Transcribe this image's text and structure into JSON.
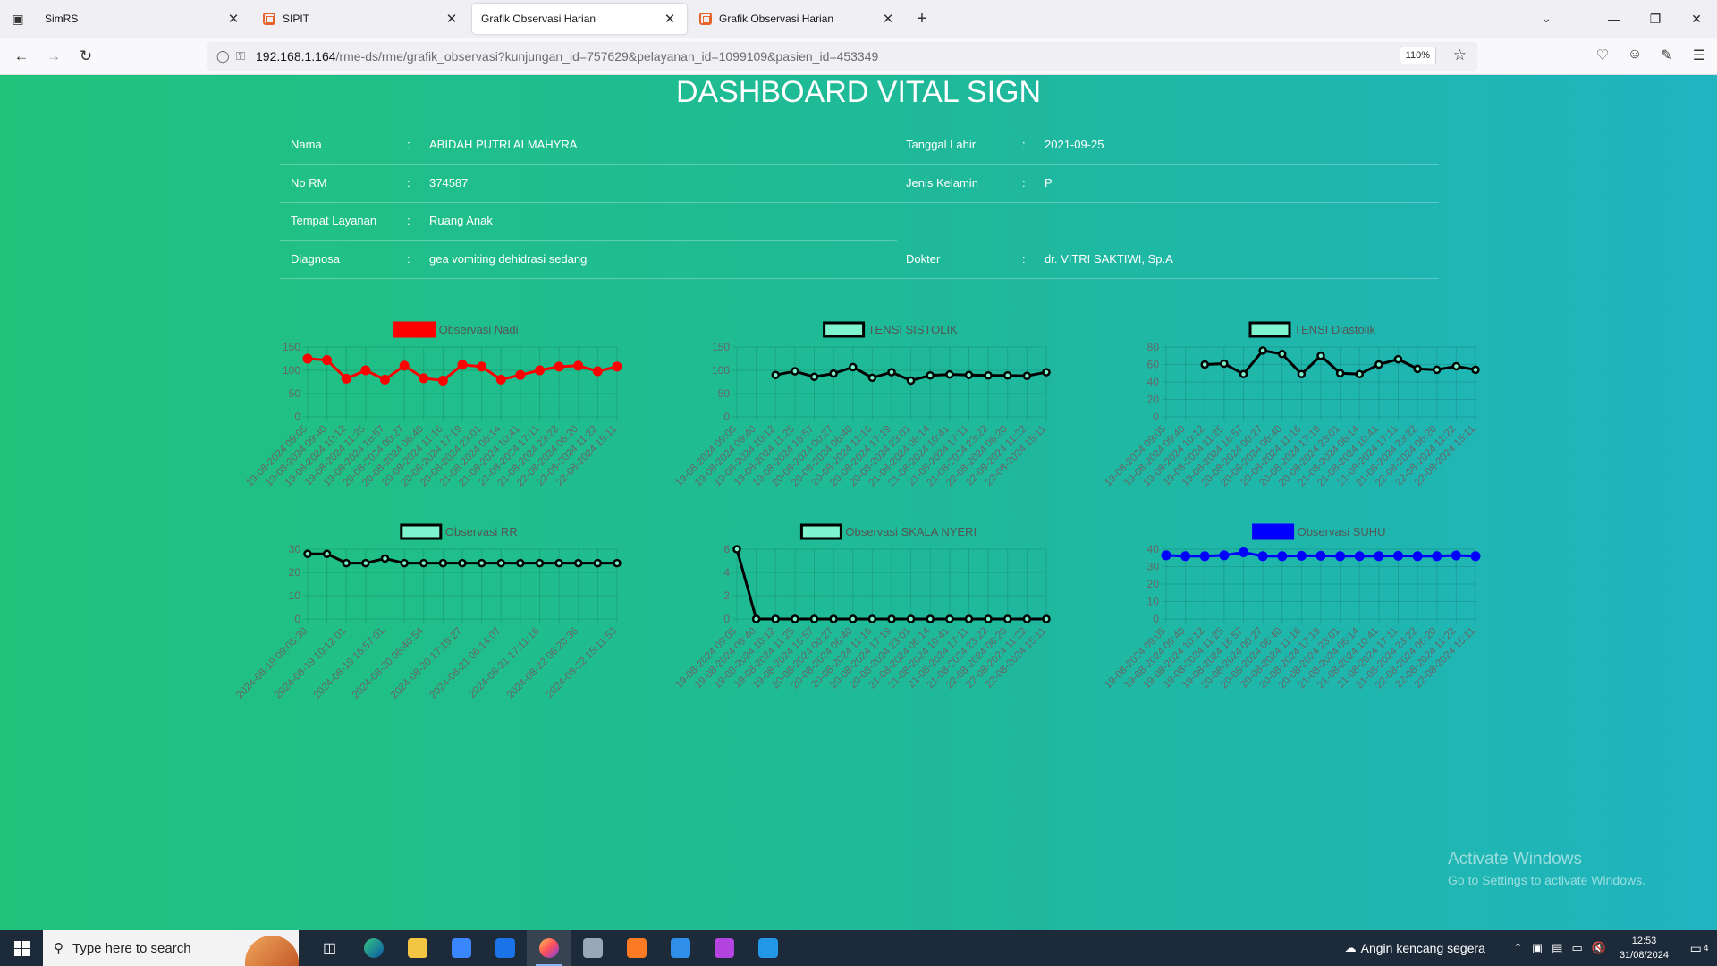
{
  "browser": {
    "tabs": [
      {
        "title": "SimRS",
        "active": false,
        "favicon": false
      },
      {
        "title": "SIPIT",
        "active": false,
        "favicon": true
      },
      {
        "title": "Grafik Observasi Harian",
        "active": true,
        "favicon": false
      },
      {
        "title": "Grafik Observasi Harian",
        "active": false,
        "favicon": true
      }
    ],
    "url_host": "192.168.1.164",
    "url_path": "/rme-ds/rme/grafik_observasi?kunjungan_id=757629&pelayanan_id=1099109&pasien_id=453349",
    "zoom": "110%"
  },
  "page": {
    "title": "DASHBOARD VITAL SIGN",
    "patient": {
      "nama_label": "Nama",
      "nama": "ABIDAH PUTRI ALMAHYRA",
      "rm_label": "No RM",
      "rm": "374587",
      "tempat_label": "Tempat Layanan",
      "tempat": "Ruang Anak",
      "diagnosa_label": "Diagnosa",
      "diagnosa": "gea vomiting dehidrasi sedang",
      "tgl_lahir_label": "Tanggal Lahir",
      "tgl_lahir": "2021-09-25",
      "jk_label": "Jenis Kelamin",
      "jk": "P",
      "dokter_label": "Dokter",
      "dokter": "dr. VITRI SAKTIWI, Sp.A",
      "sep": ":"
    },
    "watermark": {
      "line1": "Activate Windows",
      "line2": "Go to Settings to activate Windows."
    }
  },
  "chart_data": [
    {
      "type": "line",
      "title": "Observasi Nadi",
      "legend_fill": "#ff0000",
      "line_color": "#ff0000",
      "point_color": "#ff0000",
      "x": [
        "19-08-2024 09:05",
        "19-08-2024 09:40",
        "19-08-2024 10:12",
        "19-08-2024 11:25",
        "19-08-2024 16:57",
        "20-08-2024 00:27",
        "20-08-2024 06:40",
        "20-08-2024 11:16",
        "20-08-2024 17:19",
        "20-08-2024 23:01",
        "21-08-2024 06:14",
        "21-08-2024 10:41",
        "21-08-2024 17:11",
        "21-08-2024 23:22",
        "22-08-2024 06:20",
        "22-08-2024 11:22",
        "22-08-2024 15:11"
      ],
      "y": [
        125,
        122,
        82,
        100,
        80,
        110,
        83,
        78,
        112,
        108,
        80,
        90,
        100,
        108,
        110,
        98,
        108
      ],
      "yticks": [
        0,
        50,
        100,
        150
      ],
      "ylim": [
        0,
        150
      ]
    },
    {
      "type": "line",
      "title": "TENSI SISTOLIK",
      "legend_fill": "#7ef5cf",
      "line_color": "#000000",
      "point_color": "#000000",
      "x": [
        "19-08-2024 09:05",
        "19-08-2024 09:40",
        "19-08-2024 10:12",
        "19-08-2024 11:25",
        "19-08-2024 16:57",
        "20-08-2024 00:27",
        "20-08-2024 06:40",
        "20-08-2024 11:16",
        "20-08-2024 17:19",
        "20-08-2024 23:01",
        "21-08-2024 06:14",
        "21-08-2024 10:41",
        "21-08-2024 17:11",
        "21-08-2024 23:22",
        "22-08-2024 06:20",
        "22-08-2024 11:22",
        "22-08-2024 15:11"
      ],
      "y": [
        null,
        null,
        90,
        98,
        86,
        93,
        107,
        84,
        96,
        78,
        89,
        91,
        90,
        89,
        89,
        88,
        96
      ],
      "yticks": [
        0,
        50,
        100,
        150
      ],
      "ylim": [
        0,
        150
      ]
    },
    {
      "type": "line",
      "title": "TENSI Diastolik",
      "legend_fill": "#7ef5cf",
      "line_color": "#000000",
      "point_color": "#000000",
      "x": [
        "19-08-2024 09:05",
        "19-08-2024 09:40",
        "19-08-2024 10:12",
        "19-08-2024 11:25",
        "19-08-2024 16:57",
        "20-08-2024 00:27",
        "20-08-2024 06:40",
        "20-08-2024 11:16",
        "20-08-2024 17:19",
        "20-08-2024 23:01",
        "21-08-2024 06:14",
        "21-08-2024 10:41",
        "21-08-2024 17:11",
        "21-08-2024 23:22",
        "22-08-2024 06:20",
        "22-08-2024 11:22",
        "22-08-2024 15:11"
      ],
      "y": [
        null,
        null,
        60,
        61,
        49,
        76,
        72,
        49,
        70,
        50,
        49,
        60,
        66,
        55,
        54,
        58,
        54
      ],
      "yticks": [
        0,
        20,
        40,
        60,
        80
      ],
      "ylim": [
        0,
        80
      ]
    },
    {
      "type": "line",
      "title": "Observasi RR",
      "legend_fill": "#7ef5cf",
      "line_color": "#000000",
      "point_color": "#000000",
      "x": [
        "2024-08-19 09:05:30",
        "",
        "2024-08-19 10:12:01",
        "",
        "2024-08-19 16:57:01",
        "",
        "2024-08-20 06:40:54",
        "",
        "2024-08-20 17:19:27",
        "",
        "2024-08-21 06:14:07",
        "",
        "2024-08-21 17:11:16",
        "",
        "2024-08-22 06:20:36",
        "",
        "2024-08-22 15:11:53"
      ],
      "y": [
        28,
        28,
        24,
        24,
        26,
        24,
        24,
        24,
        24,
        24,
        24,
        24,
        24,
        24,
        24,
        24,
        24
      ],
      "yticks": [
        0,
        10,
        20,
        30
      ],
      "ylim": [
        0,
        30
      ]
    },
    {
      "type": "line",
      "title": "Observasi SKALA NYERI",
      "legend_fill": "#7ef5cf",
      "line_color": "#000000",
      "point_color": "#000000",
      "x": [
        "19-08-2024 09:05",
        "19-08-2024 09:40",
        "19-08-2024 10:12",
        "19-08-2024 11:25",
        "19-08-2024 16:57",
        "20-08-2024 00:27",
        "20-08-2024 06:40",
        "20-08-2024 11:16",
        "20-08-2024 17:19",
        "20-08-2024 23:01",
        "21-08-2024 06:14",
        "21-08-2024 10:41",
        "21-08-2024 17:11",
        "21-08-2024 23:22",
        "22-08-2024 06:20",
        "22-08-2024 11:22",
        "22-08-2024 15:11"
      ],
      "y": [
        6,
        0,
        0,
        0,
        0,
        0,
        0,
        0,
        0,
        0,
        0,
        0,
        0,
        0,
        0,
        0,
        0
      ],
      "yticks": [
        0,
        2,
        4,
        6
      ],
      "ylim": [
        0,
        6
      ]
    },
    {
      "type": "line",
      "title": "Observasi SUHU",
      "legend_fill": "#0000ff",
      "line_color": "#0000ff",
      "point_color": "#0000ff",
      "x": [
        "19-08-2024 09:05",
        "19-08-2024 09:40",
        "19-08-2024 10:12",
        "19-08-2024 11:25",
        "19-08-2024 16:57",
        "20-08-2024 00:27",
        "20-08-2024 06:40",
        "20-08-2024 11:16",
        "20-08-2024 17:19",
        "20-08-2024 23:01",
        "21-08-2024 06:14",
        "21-08-2024 10:41",
        "21-08-2024 17:11",
        "21-08-2024 23:22",
        "22-08-2024 06:20",
        "22-08-2024 11:22",
        "22-08-2024 15:11"
      ],
      "y": [
        36.5,
        36,
        36,
        36.5,
        38.2,
        36,
        36,
        36.2,
        36.2,
        36,
        36,
        36,
        36.2,
        36,
        36,
        36.4,
        36
      ],
      "yticks": [
        0,
        10,
        20,
        30,
        40
      ],
      "ylim": [
        0,
        40
      ]
    }
  ],
  "taskbar": {
    "search_placeholder": "Type here to search",
    "weather": "Angin kencang segera",
    "time": "12:53",
    "date": "31/08/2024",
    "notif_count": "4"
  }
}
